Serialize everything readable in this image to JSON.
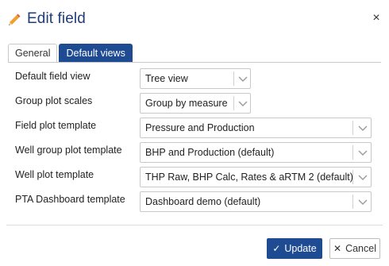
{
  "dialog": {
    "title": "Edit field",
    "title_icon": "pencil-icon",
    "close_icon": "close-icon",
    "close_glyph": "×"
  },
  "tabs": [
    {
      "label": "General",
      "active": false
    },
    {
      "label": "Default views",
      "active": true
    }
  ],
  "fields": [
    {
      "label": "Default field view",
      "value": "Tree view"
    },
    {
      "label": "Group plot scales",
      "value": "Group by measure"
    },
    {
      "label": "Field plot template",
      "value": "Pressure and Production"
    },
    {
      "label": "Well group plot template",
      "value": "BHP and Production (default)"
    },
    {
      "label": "Well plot template",
      "value": "THP Raw, BHP Calc, Rates & aRTM 2 (default)"
    },
    {
      "label": "PTA Dashboard template",
      "value": "Dashboard demo (default)"
    }
  ],
  "buttons": {
    "update_label": "Update",
    "update_icon": "check-icon",
    "update_glyph": "✓",
    "cancel_label": "Cancel",
    "cancel_icon": "x-icon",
    "cancel_glyph": "✕"
  },
  "colors": {
    "accent": "#1e4b91",
    "title": "#1f3d7a",
    "pencil": "#f0a030"
  }
}
